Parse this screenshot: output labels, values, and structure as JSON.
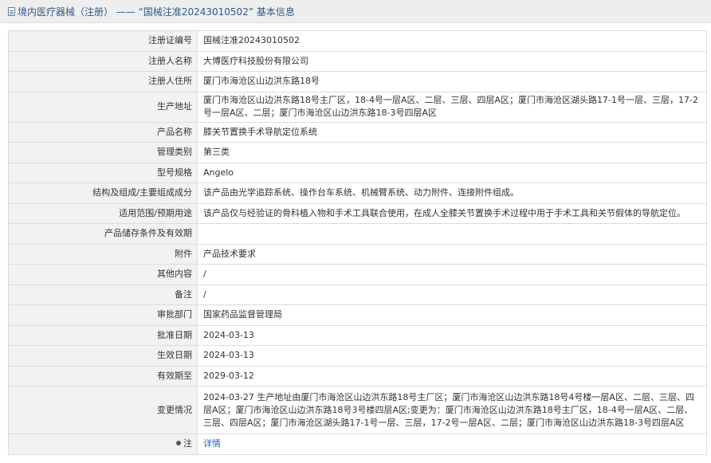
{
  "header": {
    "title": "境内医疗器械（注册） —— “国械注准20243010502” 基本信息"
  },
  "rows": [
    {
      "label": "注册证编号",
      "value": "国械注准20243010502"
    },
    {
      "label": "注册人名称",
      "value": "大博医疗科技股份有限公司"
    },
    {
      "label": "注册人住所",
      "value": "厦门市海沧区山边洪东路18号"
    },
    {
      "label": "生产地址",
      "value": "厦门市海沧区山边洪东路18号主厂区，18-4号一层A区、二层、三层、四层A区；厦门市海沧区湖头路17-1号一层、三层，17-2号一层A区、二层；厦门市海沧区山边洪东路18-3号四层A区"
    },
    {
      "label": "产品名称",
      "value": "膝关节置换手术导航定位系统"
    },
    {
      "label": "管理类别",
      "value": "第三类"
    },
    {
      "label": "型号规格",
      "value": "Angelo"
    },
    {
      "label": "结构及组成/主要组成成分",
      "value": "该产品由光学追踪系统、操作台车系统、机械臂系统、动力附件、连接附件组成。"
    },
    {
      "label": "适用范围/预期用途",
      "value": "该产品仅与经验证的骨科植入物和手术工具联合使用，在成人全膝关节置换手术过程中用于手术工具和关节假体的导航定位。"
    },
    {
      "label": "产品储存条件及有效期",
      "value": ""
    },
    {
      "label": "附件",
      "value": "产品技术要求"
    },
    {
      "label": "其他内容",
      "value": "/"
    },
    {
      "label": "备注",
      "value": "/"
    },
    {
      "label": "审批部门",
      "value": "国家药品监督管理局"
    },
    {
      "label": "批准日期",
      "value": "2024-03-13"
    },
    {
      "label": "生效日期",
      "value": "2024-03-13"
    },
    {
      "label": "有效期至",
      "value": "2029-03-12"
    },
    {
      "label": "变更情况",
      "value": "2024-03-27 生产地址由厦门市海沧区山边洪东路18号主厂区；厦门市海沧区山边洪东路18号4号楼一层A区、二层、三层、四层A区；厦门市海沧区山边洪东路18号3号楼四层A区;变更为：厦门市海沧区山边洪东路18号主厂区，18-4号一层A区、二层、三层、四层A区；厦门市海沧区湖头路17-1号一层、三层，17-2号一层A区、二层；厦门市海沧区山边洪东路18-3号四层A区"
    }
  ],
  "note": {
    "label": "注",
    "link": "详情"
  }
}
